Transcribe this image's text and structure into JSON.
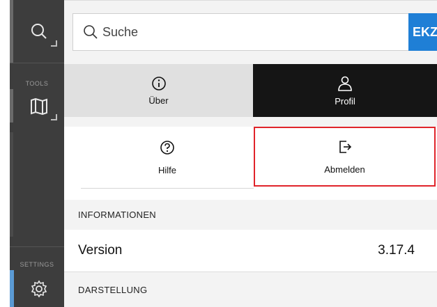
{
  "rail": {
    "tools_label": "TOOLS",
    "settings_label": "SETTINGS",
    "items": [
      {
        "icon": "search-icon"
      },
      {
        "icon": "map-icon"
      },
      {
        "icon": "gear-icon"
      }
    ],
    "colors": {
      "rail": "#3d3d3d",
      "active": "#5b9bd5"
    }
  },
  "search": {
    "placeholder": "Suche",
    "brand": "EKZ"
  },
  "tabs": [
    {
      "label": "Über",
      "icon": "info-icon",
      "active": false
    },
    {
      "label": "Profil",
      "icon": "user-icon",
      "active": true
    }
  ],
  "actions": [
    {
      "label": "Hilfe",
      "icon": "help-icon"
    },
    {
      "label": "Abmelden",
      "icon": "logout-icon",
      "highlight_color": "#e0242a"
    }
  ],
  "sections": {
    "info_title": "INFORMATIONEN",
    "version_label": "Version",
    "version_value": "3.17.4",
    "display_title": "DARSTELLUNG"
  },
  "colors": {
    "brand": "#1f7fd6",
    "highlight": "#e0242a"
  }
}
